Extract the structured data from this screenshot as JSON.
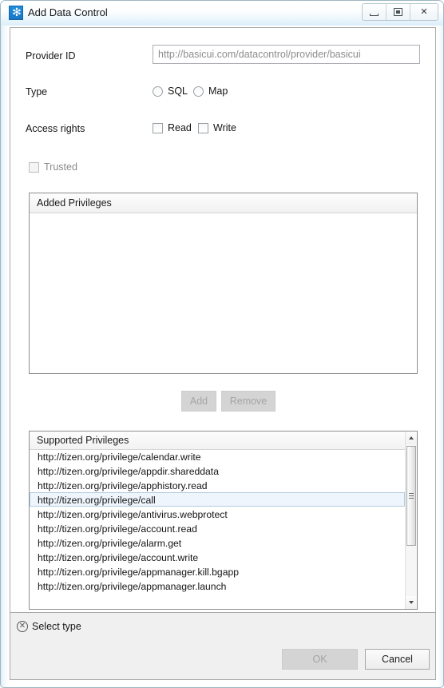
{
  "window": {
    "title": "Add Data Control",
    "icon": "tizen-star-icon",
    "controls": {
      "minimize": "minimize-button",
      "restore": "restore-button",
      "close": "close-button",
      "close_glyph": "✕"
    }
  },
  "form": {
    "provider": {
      "label": "Provider ID",
      "value": "http://basicui.com/datacontrol/provider/basicui"
    },
    "type": {
      "label": "Type",
      "options": [
        {
          "label": "SQL",
          "checked": false
        },
        {
          "label": "Map",
          "checked": false
        }
      ]
    },
    "access_rights": {
      "label": "Access rights",
      "options": [
        {
          "label": "Read",
          "checked": false
        },
        {
          "label": "Write",
          "checked": false
        }
      ]
    },
    "trusted": {
      "label": "Trusted",
      "checked": false,
      "disabled": true
    }
  },
  "added_privileges": {
    "header": "Added Privileges",
    "rows": []
  },
  "transfer_buttons": {
    "add": {
      "label": "Add",
      "disabled": true
    },
    "remove": {
      "label": "Remove",
      "disabled": true
    }
  },
  "supported_privileges": {
    "header": "Supported Privileges",
    "selected_index": 3,
    "rows": [
      "http://tizen.org/privilege/calendar.write",
      "http://tizen.org/privilege/appdir.shareddata",
      "http://tizen.org/privilege/apphistory.read",
      "http://tizen.org/privilege/call",
      "http://tizen.org/privilege/antivirus.webprotect",
      "http://tizen.org/privilege/account.read",
      "http://tizen.org/privilege/alarm.get",
      "http://tizen.org/privilege/account.write",
      "http://tizen.org/privilege/appmanager.kill.bgapp",
      "http://tizen.org/privilege/appmanager.launch"
    ]
  },
  "status": {
    "icon": "error-circle-x-icon",
    "glyph": "✕",
    "message": "Select type"
  },
  "footer": {
    "ok": {
      "label": "OK",
      "disabled": true
    },
    "cancel": {
      "label": "Cancel",
      "disabled": false
    }
  },
  "colors": {
    "selection_bg": "#eef5fc",
    "selection_border": "#b3cde2",
    "titlebar_accent": "#dceefa",
    "icon_blue": "#1877c4"
  }
}
